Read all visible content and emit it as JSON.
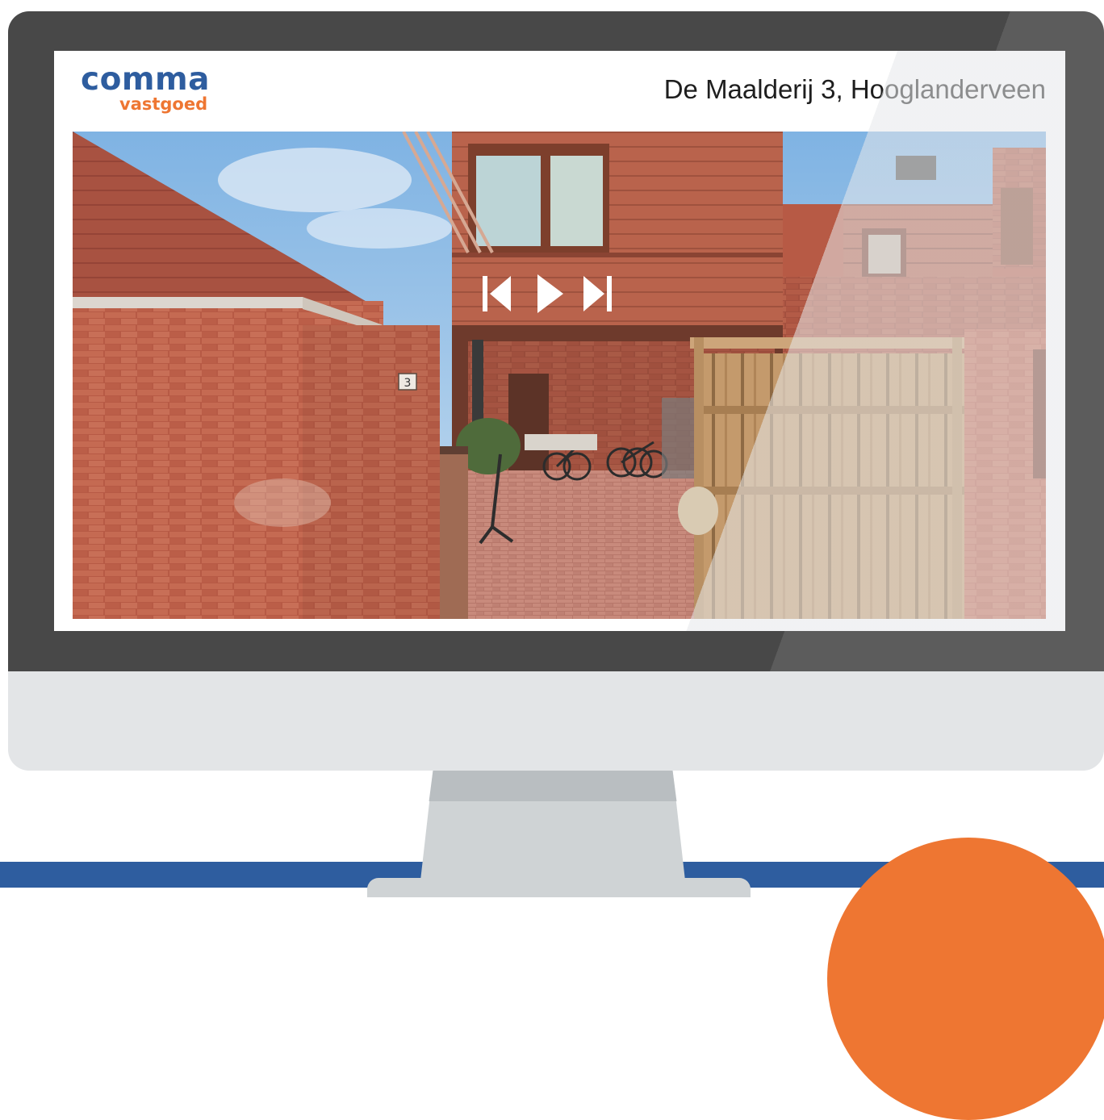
{
  "brand": {
    "logo_main": "comma",
    "logo_sub": "vastgoed",
    "blue": "#2e5d9f",
    "orange": "#ee7632"
  },
  "listing": {
    "address": "De Maalderij 3, Hooglanderveen"
  },
  "photo": {
    "house_number": "3"
  },
  "controls": {
    "previous_icon": "skip-back-icon",
    "play_icon": "play-icon",
    "next_icon": "skip-forward-icon"
  }
}
